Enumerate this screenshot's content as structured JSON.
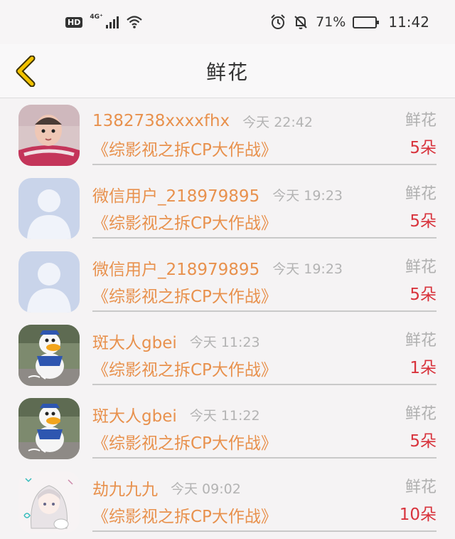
{
  "status_bar": {
    "hd": "HD",
    "network": "4G⁺",
    "battery_pct": "71%",
    "battery_level": 0.71,
    "time": "11:42"
  },
  "nav": {
    "title": "鲜花"
  },
  "records": [
    {
      "name": "1382738xxxxfhx",
      "time": "今天 22:42",
      "type": "鲜花",
      "book": "《综影视之拆CP大作战》",
      "count": "5朵",
      "avatar": "baby-photo"
    },
    {
      "name": "微信用户_218979895",
      "time": "今天 19:23",
      "type": "鲜花",
      "book": "《综影视之拆CP大作战》",
      "count": "5朵",
      "avatar": "default-silhouette"
    },
    {
      "name": "微信用户_218979895",
      "time": "今天 19:23",
      "type": "鲜花",
      "book": "《综影视之拆CP大作战》",
      "count": "5朵",
      "avatar": "default-silhouette"
    },
    {
      "name": "斑大人gbei",
      "time": "今天 11:23",
      "type": "鲜花",
      "book": "《综影视之拆CP大作战》",
      "count": "1朵",
      "avatar": "donald-duck-photo"
    },
    {
      "name": "斑大人gbei",
      "time": "今天 11:22",
      "type": "鲜花",
      "book": "《综影视之拆CP大作战》",
      "count": "5朵",
      "avatar": "donald-duck-photo"
    },
    {
      "name": "劫九九九",
      "time": "今天 09:02",
      "type": "鲜花",
      "book": "《综影视之拆CP大作战》",
      "count": "10朵",
      "avatar": "anime-girl-drawing"
    }
  ],
  "colors": {
    "accent_orange": "#e8914d",
    "count_red": "#d8333c",
    "back_arrow": "#f2c200"
  }
}
